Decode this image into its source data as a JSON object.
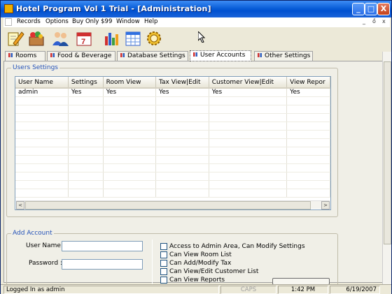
{
  "window": {
    "title": "Hotel Program Vol 1 Trial - [Administration]",
    "controls": {
      "minimize": "_",
      "maximize": "□",
      "close": "X"
    },
    "colors": {
      "titlebar": "#0a5fd8",
      "accent": "#2452b8"
    }
  },
  "menu": {
    "items": [
      "Records",
      "Options",
      "Buy Only $99",
      "Window",
      "Help"
    ],
    "mdi_controls": [
      "_",
      "ő",
      "x"
    ]
  },
  "toolbar": {
    "icons": [
      "edit-icon",
      "food-box-icon",
      "users-icon",
      "calendar-icon",
      "bar-chart-icon",
      "table-icon",
      "settings-gear-icon"
    ]
  },
  "tabs": [
    {
      "label": "Rooms",
      "active": false
    },
    {
      "label": "Food & Beverage",
      "active": false
    },
    {
      "label": "Database Settings",
      "active": false
    },
    {
      "label": "User Accounts",
      "active": true
    },
    {
      "label": "Other Settings",
      "active": false
    }
  ],
  "users_settings": {
    "group_title": "Users Settings",
    "columns": [
      "User Name",
      "Settings",
      "Room View",
      "Tax View|Edit",
      "Customer View|Edit",
      "View Repor"
    ],
    "rows": [
      [
        "admin",
        "Yes",
        "Yes",
        "Yes",
        "Yes",
        "Yes"
      ]
    ],
    "scroll_left": "<",
    "scroll_right": ">"
  },
  "add_account": {
    "group_title": "Add Account",
    "user_name_label": "User Name :",
    "password_label": "Password :",
    "permissions": [
      "Access to Admin Area, Can Modify Settings",
      "Can View Room List",
      "Can Add/Modify Tax",
      "Can View/Edit Customer List",
      "Can View Reports"
    ]
  },
  "statusbar": {
    "logged_in": "Logged In as admin",
    "caps": "CAPS",
    "time": "1:42 PM",
    "date": "6/19/2007"
  }
}
